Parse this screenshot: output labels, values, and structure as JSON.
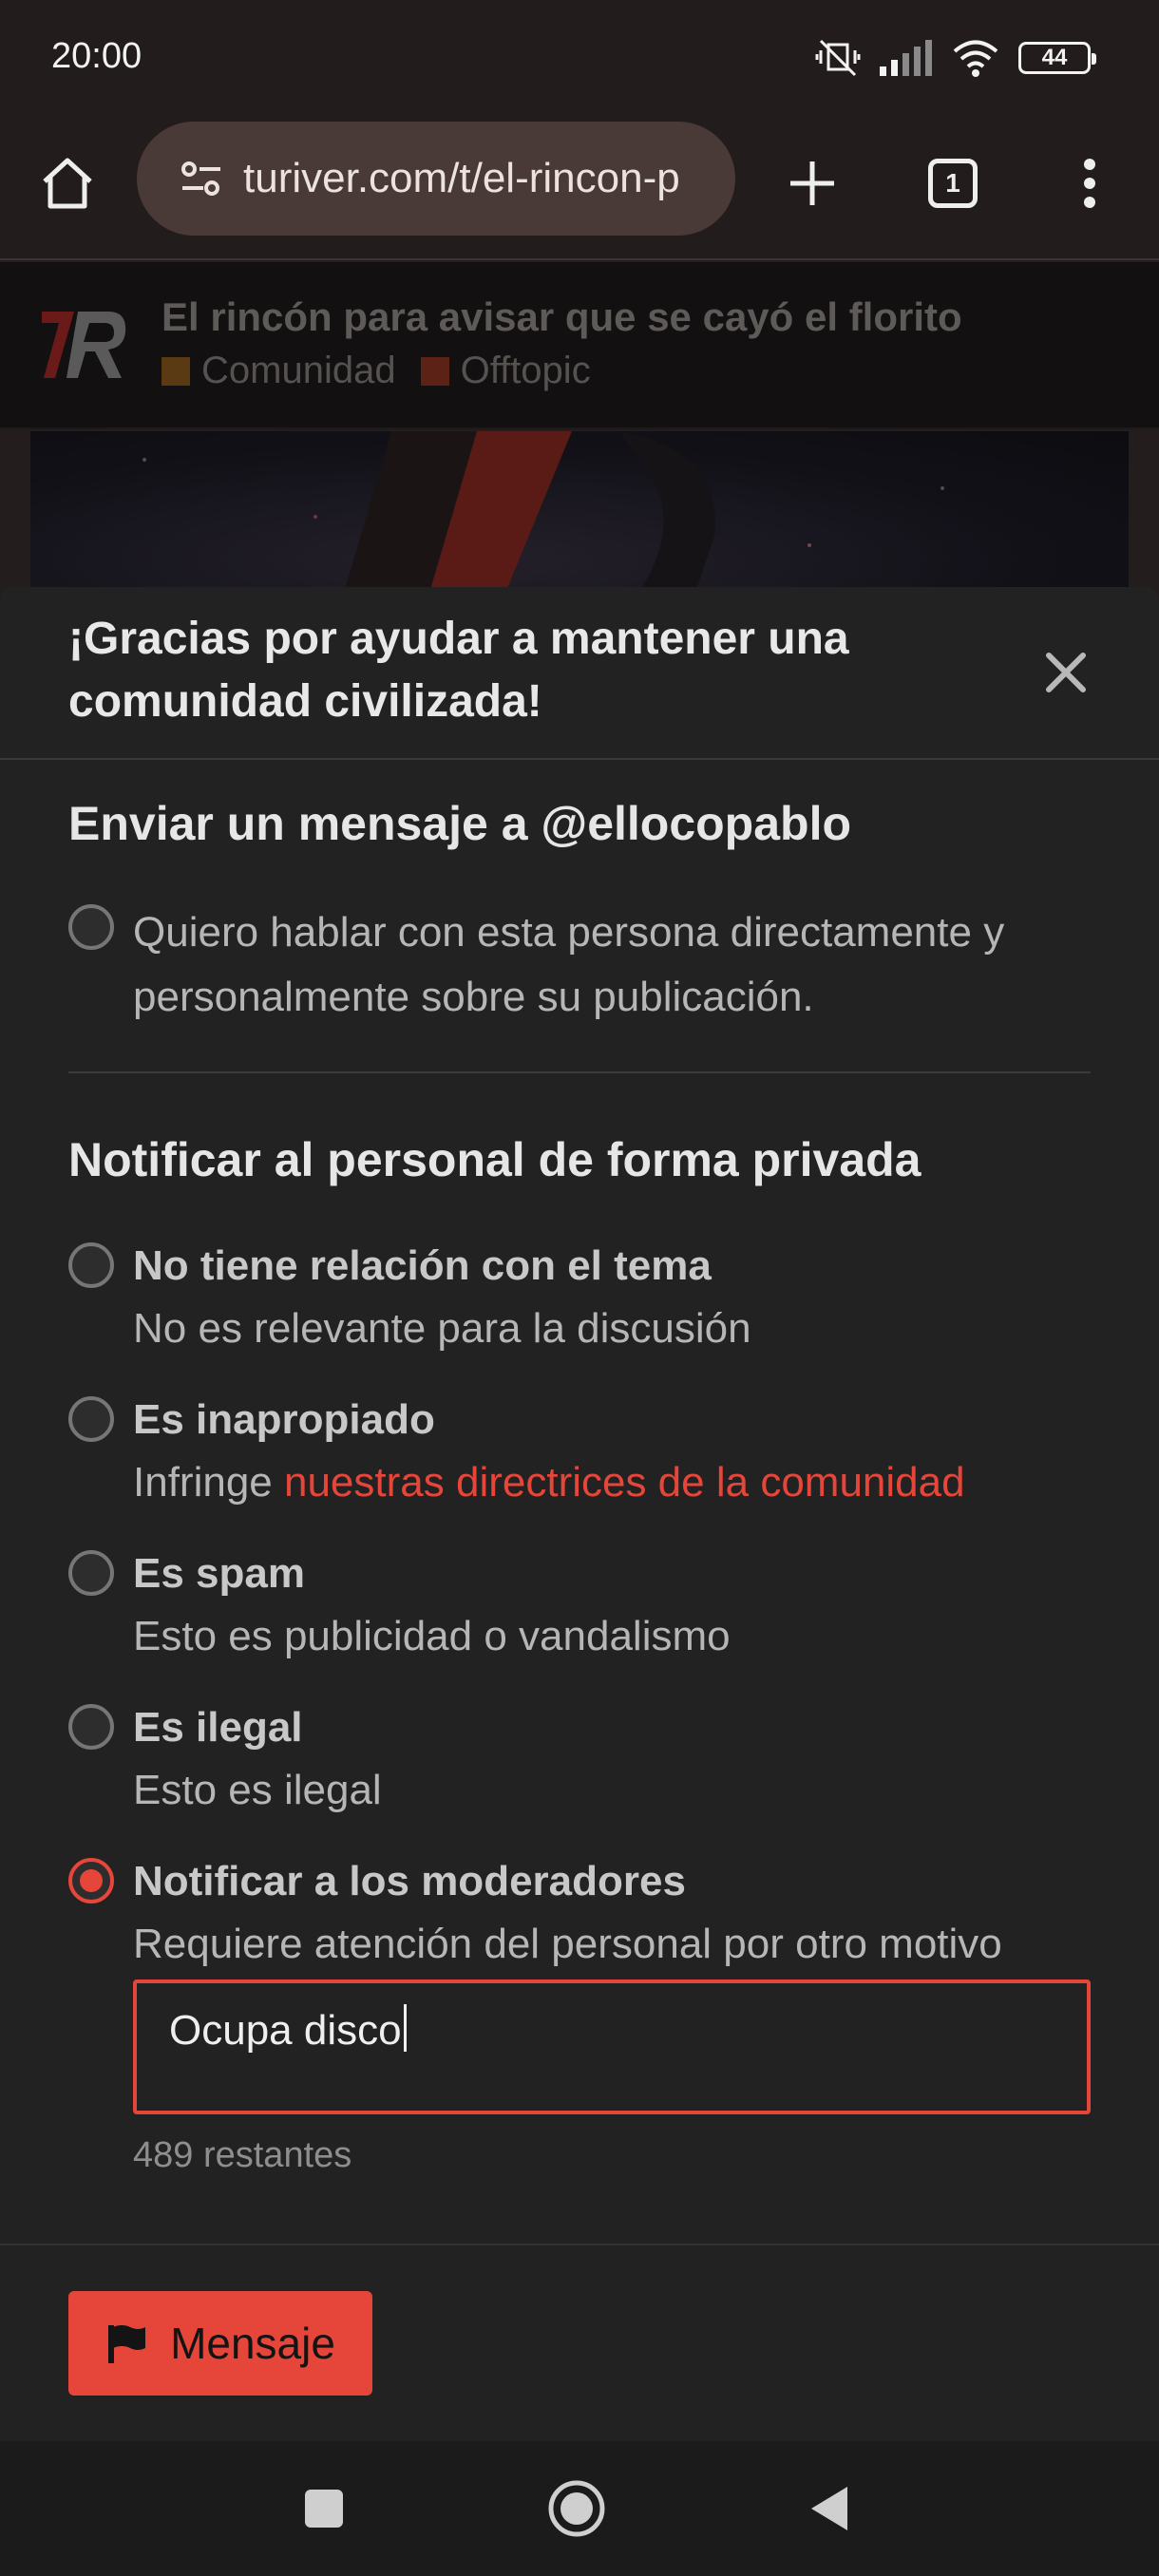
{
  "status_bar": {
    "time": "20:00",
    "battery": "44",
    "icons": [
      "mute-vibrate-icon",
      "signal-icon",
      "wifi-icon",
      "battery-icon"
    ]
  },
  "browser": {
    "url": "turiver.com/t/el-rincon-p",
    "tab_count": "1",
    "icons": [
      "home-icon",
      "site-settings-icon",
      "new-tab-icon",
      "tab-switcher-icon",
      "more-menu-icon"
    ]
  },
  "topic": {
    "title": "El rincón para avisar que se cayó el florito",
    "categories": [
      {
        "name": "Comunidad",
        "color": "#a06414"
      },
      {
        "name": "Offtopic",
        "color": "#b3381f"
      }
    ]
  },
  "modal": {
    "title": "¡Gracias por ayudar a mantener una comunidad civilizada!",
    "message_section": {
      "title": "Enviar un mensaje a @ellocopablo",
      "option_text": "Quiero hablar con esta persona directamente y personalmente sobre su publicación."
    },
    "notify_section": {
      "title": "Notificar al personal de forma privada",
      "options": [
        {
          "label": "No tiene relación con el tema",
          "desc": "No es relevante para la discusión",
          "checked": false
        },
        {
          "label": "Es inapropiado",
          "desc_prefix": "Infringe ",
          "desc_link": "nuestras directrices de la comunidad",
          "checked": false
        },
        {
          "label": "Es spam",
          "desc": "Esto es publicidad o vandalismo",
          "checked": false
        },
        {
          "label": "Es ilegal",
          "desc": "Esto es ilegal",
          "checked": false
        },
        {
          "label": "Notificar a los moderadores",
          "desc": "Requiere atención del personal por otro motivo",
          "checked": true
        }
      ]
    },
    "reason_input": {
      "value": "Ocupa disco"
    },
    "chars_left": "489 restantes",
    "submit_label": "Mensaje"
  },
  "colors": {
    "accent": "#e6463a",
    "modal_bg": "#222222",
    "browser_bg": "#231c1c"
  }
}
